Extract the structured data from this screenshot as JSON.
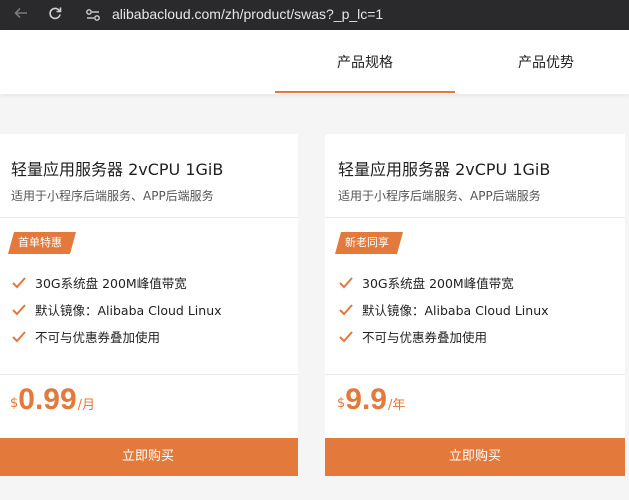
{
  "browser": {
    "url": "alibabacloud.com/zh/product/swas?_p_lc=1",
    "back_icon": "arrow-left",
    "reload_icon": "reload",
    "site_info_icon": "tune-sliders"
  },
  "tabs": [
    {
      "label": "产品规格",
      "active": true
    },
    {
      "label": "产品优势",
      "active": false
    }
  ],
  "colors": {
    "accent": "#e3793a"
  },
  "cards": [
    {
      "title": "轻量应用服务器 2vCPU 1GiB",
      "subtitle": "适用于小程序后端服务、APP后端服务",
      "badge": "首单特惠",
      "features": [
        "30G系统盘 200M峰值带宽",
        "默认镜像：Alibaba Cloud Linux",
        "不可与优惠券叠加使用"
      ],
      "currency": "$",
      "price": "0.99",
      "unit": "/月",
      "button": "立即购买"
    },
    {
      "title": "轻量应用服务器 2vCPU 1GiB",
      "subtitle": "适用于小程序后端服务、APP后端服务",
      "badge": "新老同享",
      "features": [
        "30G系统盘 200M峰值带宽",
        "默认镜像：Alibaba Cloud Linux",
        "不可与优惠券叠加使用"
      ],
      "currency": "$",
      "price": "9.9",
      "unit": "/年",
      "button": "立即购买"
    }
  ]
}
